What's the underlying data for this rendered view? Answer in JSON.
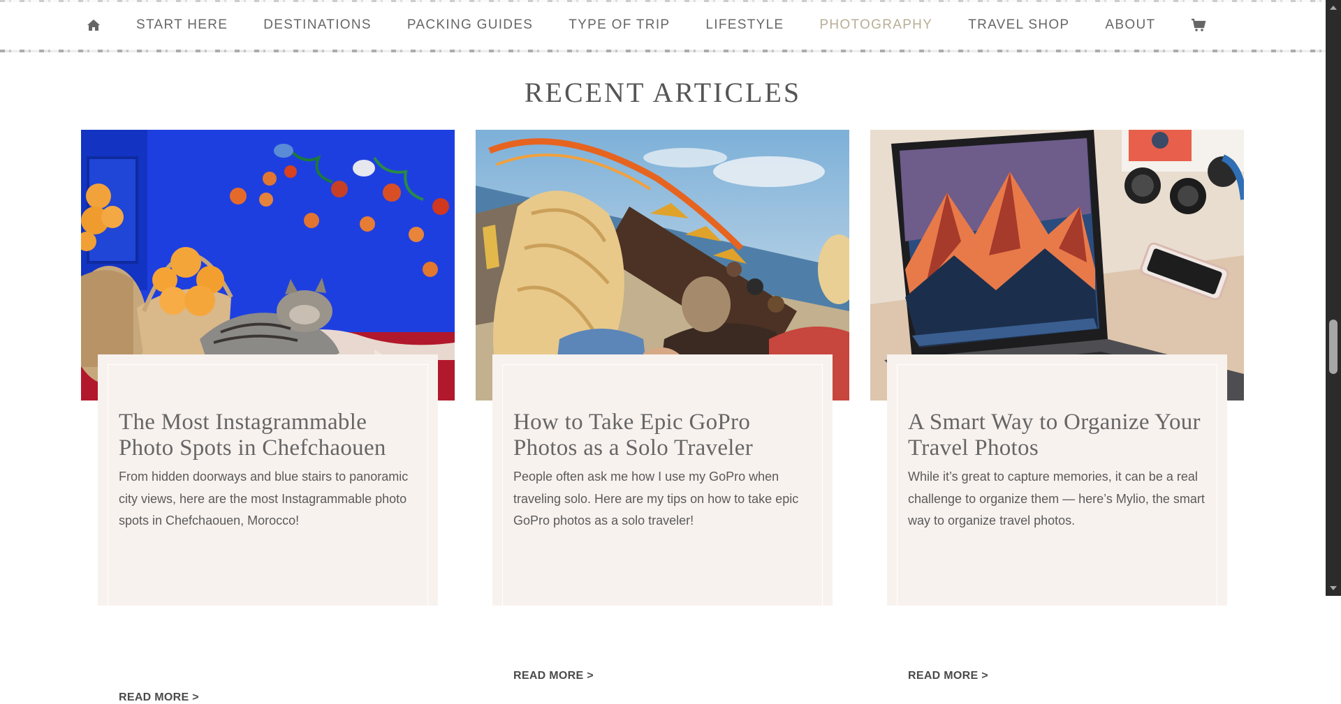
{
  "nav": {
    "items": [
      {
        "label": "START HERE"
      },
      {
        "label": "DESTINATIONS"
      },
      {
        "label": "PACKING GUIDES"
      },
      {
        "label": "TYPE OF TRIP"
      },
      {
        "label": "LIFESTYLE"
      },
      {
        "label": "PHOTOGRAPHY",
        "active": true
      },
      {
        "label": "TRAVEL SHOP"
      },
      {
        "label": "ABOUT"
      }
    ],
    "home_icon": "home-icon",
    "cart_icon": "cart-icon",
    "active_color": "#b9ae95"
  },
  "section": {
    "title": "RECENT ARTICLES"
  },
  "articles": [
    {
      "title": "The Most Instagrammable Photo Spots in Chefchaouen",
      "excerpt": "From hidden doorways and blue stairs to panoramic city views, here are the most Instagrammable photo spots in Chefchaouen, Morocco!",
      "read_more": "READ MORE >",
      "image": "cat-with-oranges-on-blue-wall"
    },
    {
      "title": "How to Take Epic GoPro Photos as a Solo Traveler",
      "excerpt": "People often ask me how I use my GoPro when traveling solo. Here are my tips on how to take epic GoPro photos as a solo traveler!",
      "read_more": "READ MORE >",
      "image": "rollercoaster-selfie-by-sea"
    },
    {
      "title": "A Smart Way to Organize Your Travel Photos",
      "excerpt": "While it’s great to capture memories, it can be a real challenge to organize them — here’s Mylio, the smart way to organize travel photos.",
      "read_more": "READ MORE >",
      "image": "laptop-with-camera-lenses"
    }
  ],
  "colors": {
    "card_bg": "#f8f2ef",
    "text": "#555555"
  }
}
